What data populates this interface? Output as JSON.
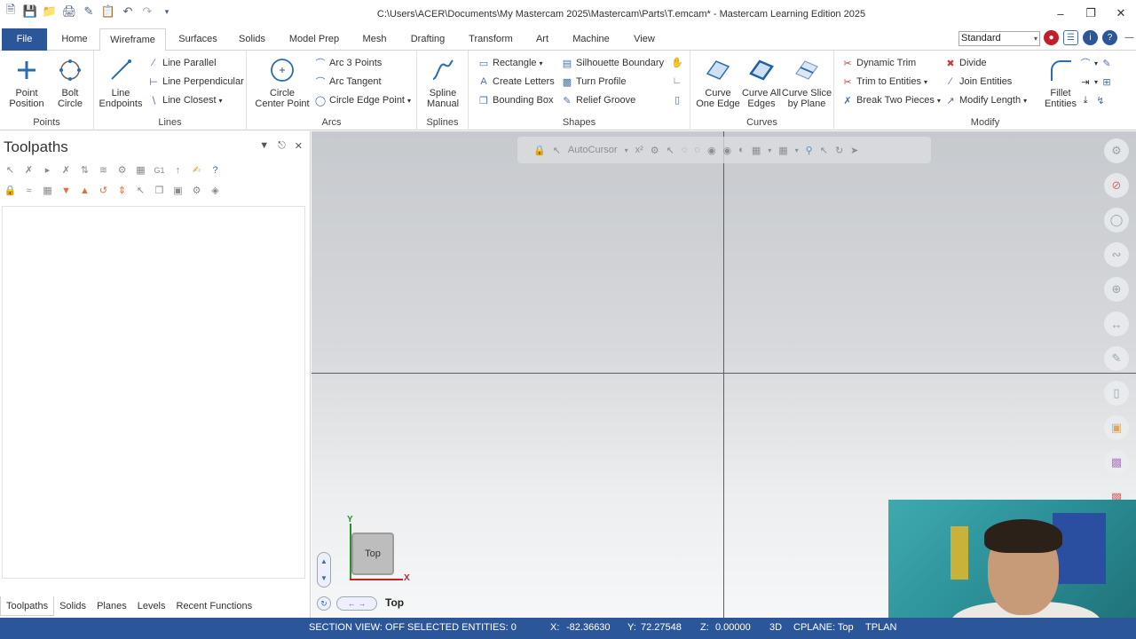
{
  "window": {
    "title": "C:\\Users\\ACER\\Documents\\My Mastercam 2025\\Mastercam\\Parts\\T.emcam* - Mastercam Learning Edition 2025",
    "controls": [
      "minimize-icon",
      "restore-icon",
      "close-icon"
    ]
  },
  "quick_access": [
    "new-file-icon",
    "save-icon",
    "open-folder-icon",
    "print-icon",
    "save-as-icon",
    "clipboard-icon",
    "undo-icon",
    "redo-icon",
    "customize-icon"
  ],
  "ribbon_tabs": [
    "File",
    "Home",
    "Wireframe",
    "Surfaces",
    "Solids",
    "Model Prep",
    "Mesh",
    "Drafting",
    "Transform",
    "Art",
    "Machine",
    "View"
  ],
  "active_tab": "Wireframe",
  "standard_select": {
    "value": "Standard"
  },
  "groups": {
    "points": {
      "label": "Points",
      "point_position": "Point\nPosition",
      "bolt_circle": "Bolt\nCircle"
    },
    "lines": {
      "label": "Lines",
      "line_endpoints": "Line\nEndpoints",
      "line_parallel": "Line Parallel",
      "line_perpendicular": "Line Perpendicular",
      "line_closest": "Line Closest"
    },
    "arcs": {
      "label": "Arcs",
      "circle_center_point": "Circle\nCenter Point",
      "arc_3_points": "Arc 3 Points",
      "arc_tangent": "Arc Tangent",
      "circle_edge_point": "Circle Edge Point"
    },
    "splines": {
      "label": "Splines",
      "spline_manual": "Spline\nManual"
    },
    "shapes": {
      "label": "Shapes",
      "rectangle": "Rectangle",
      "create_letters": "Create Letters",
      "bounding_box": "Bounding Box",
      "silhouette_boundary": "Silhouette Boundary",
      "turn_profile": "Turn Profile",
      "relief_groove": "Relief Groove"
    },
    "curves": {
      "label": "Curves",
      "curve_one_edge": "Curve\nOne Edge",
      "curve_all_edges": "Curve All\nEdges",
      "curve_slice_by_plane": "Curve Slice\nby Plane"
    },
    "modify": {
      "label": "Modify",
      "dynamic_trim": "Dynamic Trim",
      "trim_to_entities": "Trim to Entities",
      "break_two_pieces": "Break Two Pieces",
      "divide": "Divide",
      "join_entities": "Join Entities",
      "modify_length": "Modify Length",
      "fillet_entities": "Fillet\nEntities"
    }
  },
  "panel": {
    "title": "Toolpaths",
    "tabs": [
      "Toolpaths",
      "Solids",
      "Planes",
      "Levels",
      "Recent Functions"
    ],
    "active_tab": "Toolpaths"
  },
  "viewport": {
    "floatbar_label": "AutoCursor",
    "view_cube_label": "Top",
    "view_name": "Top",
    "axis_y": "Y",
    "axis_x": "X"
  },
  "status": {
    "section_view": "SECTION VIEW: OFF",
    "selected_entities": "SELECTED ENTITIES: 0",
    "x_label": "X:",
    "x_value": "-82.36630",
    "y_label": "Y:",
    "y_value": "72.27548",
    "z_label": "Z:",
    "z_value": "0.00000",
    "mode": "3D",
    "cplane": "CPLANE: Top",
    "tplane": "TPLAN"
  },
  "colors": {
    "accent": "#2b579a",
    "axis_x": "#cc2020",
    "axis_y": "#2e8b2e"
  }
}
